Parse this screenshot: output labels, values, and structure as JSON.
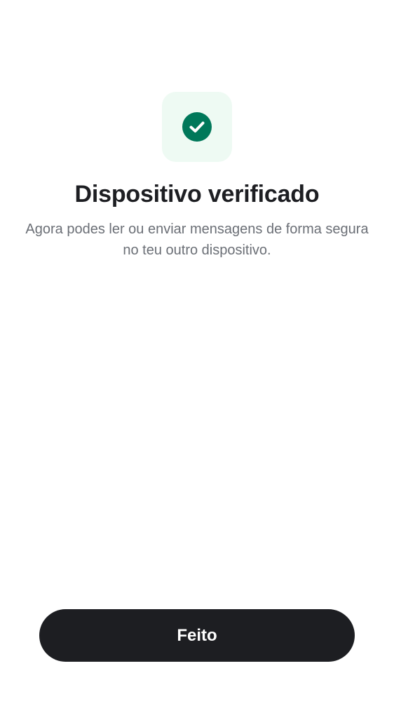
{
  "screen": {
    "icon": "check-circle-icon",
    "title": "Dispositivo verificado",
    "description": "Agora podes ler ou enviar mensagens de forma segura no teu outro dispositivo.",
    "done_label": "Feito"
  },
  "colors": {
    "accent": "#00785a",
    "tile_bg": "#eefaf3",
    "button_bg": "#1d1e22",
    "title_text": "#1d1e22",
    "body_text": "#6b6f76"
  }
}
